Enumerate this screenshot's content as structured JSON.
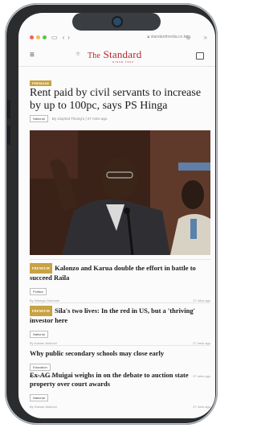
{
  "browser": {
    "url": "standardmedia.co.ke",
    "dot_colors": [
      "#f0625a",
      "#f5be4f",
      "#58c645"
    ]
  },
  "site": {
    "logo_main": "The Standard",
    "logo_the": "The",
    "logo_name": "Standard",
    "logo_sub": "SINCE 1902"
  },
  "lead": {
    "badge": "PREMIUM",
    "title": "Rent paid by civil servants to increase by up to 100pc, says PS Hinga",
    "tag": "National",
    "meta": "By Josphat Thiong'o | 27 mins ago"
  },
  "articles": [
    {
      "badge": "PREMIUM",
      "title": "Kalonzo and Karua double the effort in battle to succeed Raila",
      "tag": "Politics",
      "author": "By Ndungu Gachane",
      "time": "27 mins ago"
    },
    {
      "badge": "PREMIUM",
      "title": "Sila's two lives: In the red in US, but a 'thriving' investor here",
      "tag": "National",
      "author": "By Kamau Muthoni",
      "time": "27 mins ago"
    },
    {
      "badge": "",
      "title": "Why public secondary schools may close early",
      "tag": "Education",
      "author": "By Lewis Nyaundi",
      "time": "27 mins ago"
    },
    {
      "badge": "",
      "title": "Ex-AG Muigai weighs in on the debate to auction state property over court awards",
      "tag": "National",
      "author": "By Kamau Muthoni",
      "time": "27 mins ago"
    }
  ],
  "colors": {
    "brand_red": "#b8252a",
    "premium_gold": "#c8a243"
  }
}
